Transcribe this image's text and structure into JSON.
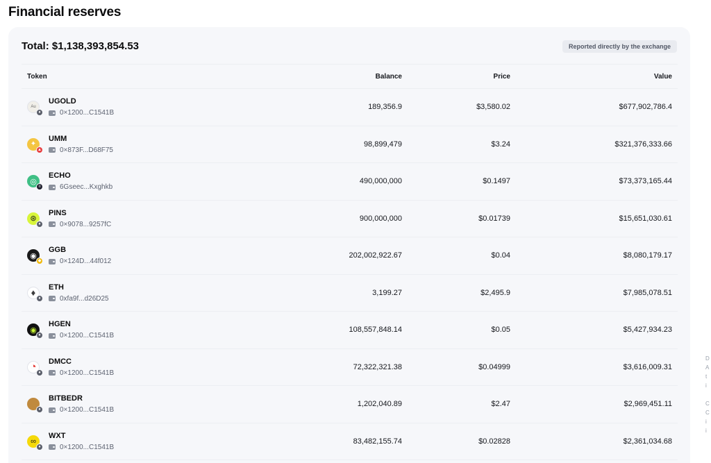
{
  "page_title": "Financial reserves",
  "total_label": "Total: $1,138,393,854.53",
  "badge": "Reported directly by the exchange",
  "columns": {
    "token": "Token",
    "balance": "Balance",
    "price": "Price",
    "value": "Value"
  },
  "rows": [
    {
      "symbol": "UGOLD",
      "address": "0×1200...C1541B",
      "balance": "189,356.9",
      "price": "$3,580.02",
      "value": "$677,902,786.4",
      "icon": "ugold-icon",
      "chain": "ethereum-icon"
    },
    {
      "symbol": "UMM",
      "address": "0×873F...D68F75",
      "balance": "98,899,479",
      "price": "$3.24",
      "value": "$321,376,333.66",
      "icon": "umm-icon",
      "chain": "avalanche-icon"
    },
    {
      "symbol": "ECHO",
      "address": "6Gseec...Kxghkb",
      "balance": "490,000,000",
      "price": "$0.1497",
      "value": "$73,373,165.44",
      "icon": "echo-icon",
      "chain": "solana-icon"
    },
    {
      "symbol": "PINS",
      "address": "0×9078...9257fC",
      "balance": "900,000,000",
      "price": "$0.01739",
      "value": "$15,651,030.61",
      "icon": "pins-icon",
      "chain": "ethereum-icon"
    },
    {
      "symbol": "GGB",
      "address": "0×124D...44f012",
      "balance": "202,002,922.67",
      "price": "$0.04",
      "value": "$8,080,179.17",
      "icon": "ggb-icon",
      "chain": "bnb-icon"
    },
    {
      "symbol": "ETH",
      "address": "0xfa9f...d26D25",
      "balance": "3,199.27",
      "price": "$2,495.9",
      "value": "$7,985,078.51",
      "icon": "eth-icon",
      "chain": "ethereum-icon"
    },
    {
      "symbol": "HGEN",
      "address": "0×1200...C1541B",
      "balance": "108,557,848.14",
      "price": "$0.05",
      "value": "$5,427,934.23",
      "icon": "hgen-icon",
      "chain": "ethereum-icon"
    },
    {
      "symbol": "DMCC",
      "address": "0×1200...C1541B",
      "balance": "72,322,321.38",
      "price": "$0.04999",
      "value": "$3,616,009.31",
      "icon": "dmcc-icon",
      "chain": "ethereum-icon"
    },
    {
      "symbol": "BITBEDR",
      "address": "0×1200...C1541B",
      "balance": "1,202,040.89",
      "price": "$2.47",
      "value": "$2,969,451.11",
      "icon": "bitbedr-icon",
      "chain": "ethereum-icon"
    },
    {
      "symbol": "WXT",
      "address": "0×1200...C1541B",
      "balance": "83,482,155.74",
      "price": "$0.02828",
      "value": "$2,361,034.68",
      "icon": "wxt-icon",
      "chain": "ethereum-icon"
    }
  ],
  "right_edge_text": [
    "D",
    "A",
    "t",
    "i",
    "",
    "C",
    "C",
    "i",
    "i"
  ]
}
